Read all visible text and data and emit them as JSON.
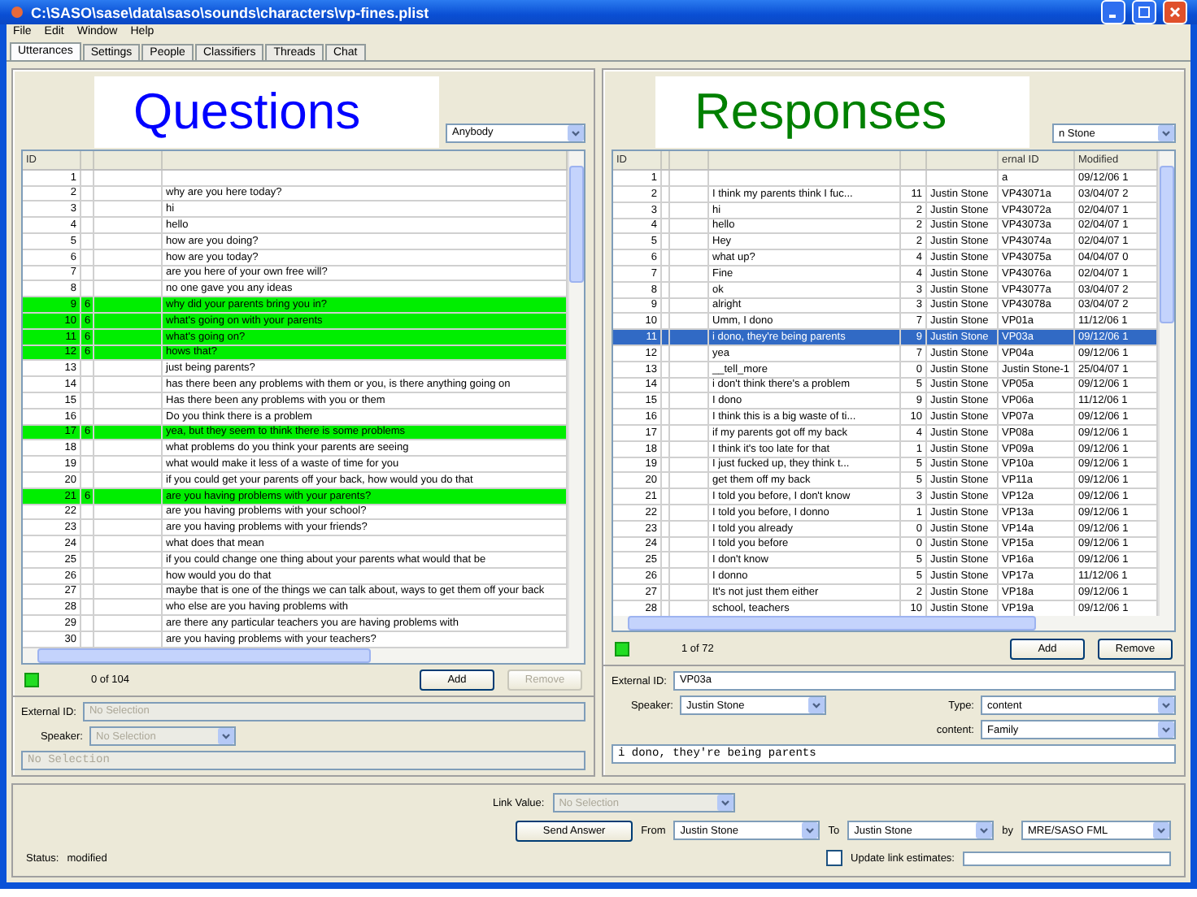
{
  "window": {
    "title": "C:\\SASO\\sase\\data\\saso\\sounds\\characters\\vp-fines.plist"
  },
  "menu": [
    "File",
    "Edit",
    "Window",
    "Help"
  ],
  "tabs": [
    {
      "label": "Utterances",
      "selected": true
    },
    {
      "label": "Settings",
      "selected": false
    },
    {
      "label": "People",
      "selected": false
    },
    {
      "label": "Classifiers",
      "selected": false
    },
    {
      "label": "Threads",
      "selected": false
    },
    {
      "label": "Chat",
      "selected": false
    }
  ],
  "questions": {
    "overlay": {
      "text": "Questions",
      "color": "#0000ff"
    },
    "filter": "Anybody",
    "header": {
      "number": "ID"
    },
    "rows": [
      {
        "number": "1",
        "highlighted": false
      },
      {
        "number": "2",
        "text": "why are you here today?",
        "highlighted": false
      },
      {
        "number": "3",
        "text": "hi",
        "highlighted": false
      },
      {
        "number": "4",
        "text": "hello",
        "highlighted": false
      },
      {
        "number": "5",
        "text": "how are you doing?",
        "highlighted": false
      },
      {
        "number": "6",
        "text": "how are you today?",
        "highlighted": false
      },
      {
        "number": "7",
        "text": "are you here of your own free will?",
        "highlighted": false
      },
      {
        "number": "8",
        "text": "no one gave you any ideas",
        "highlighted": false
      },
      {
        "number": "9",
        "mark": "6",
        "text": "why did your parents bring you in?",
        "highlighted": true
      },
      {
        "number": "10",
        "mark": "6",
        "text": "what's going on with your parents",
        "highlighted": true
      },
      {
        "number": "11",
        "mark": "6",
        "text": "what's going on?",
        "highlighted": true
      },
      {
        "number": "12",
        "mark": "6",
        "text": "hows that?",
        "highlighted": true
      },
      {
        "number": "13",
        "text": "just being parents?",
        "highlighted": false
      },
      {
        "number": "14",
        "text": "has there been any problems with them or you, is there anything going on",
        "highlighted": false
      },
      {
        "number": "15",
        "text": "Has there been any problems with you or them",
        "highlighted": false
      },
      {
        "number": "16",
        "text": "Do you think there is a problem",
        "highlighted": false
      },
      {
        "number": "17",
        "mark": "6",
        "text": "yea, but they seem to think there is some problems",
        "highlighted": true
      },
      {
        "number": "18",
        "text": "what problems do you think your parents are seeing",
        "highlighted": false
      },
      {
        "number": "19",
        "text": "what would make it less of a waste of time for you",
        "highlighted": false
      },
      {
        "number": "20",
        "text": "if you could get your parents off your back, how would you do that",
        "highlighted": false
      },
      {
        "number": "21",
        "mark": "6",
        "text": "are you having problems with your parents?",
        "highlighted": true
      },
      {
        "number": "22",
        "text": "are you having problems with your school?",
        "highlighted": false
      },
      {
        "number": "23",
        "text": "are you having problems with your friends?",
        "highlighted": false
      },
      {
        "number": "24",
        "text": "what does that mean",
        "highlighted": false
      },
      {
        "number": "25",
        "text": "if you could change one thing about your parents what would that be",
        "highlighted": false
      },
      {
        "number": "26",
        "text": "how would you do that",
        "highlighted": false
      },
      {
        "number": "27",
        "text": "maybe that is one of the things we can talk about, ways to get them off your back",
        "highlighted": false
      },
      {
        "number": "28",
        "text": "who else are you having problems with",
        "highlighted": false
      },
      {
        "number": "29",
        "text": "are there any particular teachers you are having problems with",
        "highlighted": false
      },
      {
        "number": "30",
        "text": "are you having problems with your teachers?",
        "highlighted": false
      }
    ],
    "count": "0 of 104",
    "buttons": [
      {
        "label": "Add",
        "disabled": false
      },
      {
        "label": "Remove",
        "disabled": true
      }
    ],
    "external_id": {
      "label": "External ID:",
      "value": "No Selection",
      "disabled": true
    },
    "speaker": {
      "label": "Speaker:",
      "value": "No Selection",
      "disabled": true
    },
    "text": {
      "value": "No Selection",
      "disabled": true
    }
  },
  "responses": {
    "overlay": {
      "text": "Responses",
      "color": "#008000"
    },
    "filter": "n Stone",
    "header": {
      "number": "ID",
      "external_id": "ernal ID",
      "modified": "Modified"
    },
    "rows": [
      {
        "number": "1",
        "external_id": "a",
        "modified": "09/12/06 1",
        "selected": false
      },
      {
        "number": "2",
        "text": "I think my parents think I fuc...",
        "count": "11",
        "speaker": "Justin Stone",
        "external_id": "VP43071a",
        "modified": "03/04/07 2",
        "selected": false
      },
      {
        "number": "3",
        "text": "hi",
        "count": "2",
        "speaker": "Justin Stone",
        "external_id": "VP43072a",
        "modified": "02/04/07 1",
        "selected": false
      },
      {
        "number": "4",
        "text": "hello",
        "count": "2",
        "speaker": "Justin Stone",
        "external_id": "VP43073a",
        "modified": "02/04/07 1",
        "selected": false
      },
      {
        "number": "5",
        "text": "Hey",
        "count": "2",
        "speaker": "Justin Stone",
        "external_id": "VP43074a",
        "modified": "02/04/07 1",
        "selected": false
      },
      {
        "number": "6",
        "text": "what up?",
        "count": "4",
        "speaker": "Justin Stone",
        "external_id": "VP43075a",
        "modified": "04/04/07 0",
        "selected": false
      },
      {
        "number": "7",
        "text": "Fine",
        "count": "4",
        "speaker": "Justin Stone",
        "external_id": "VP43076a",
        "modified": "02/04/07 1",
        "selected": false
      },
      {
        "number": "8",
        "text": "ok",
        "count": "3",
        "speaker": "Justin Stone",
        "external_id": "VP43077a",
        "modified": "03/04/07 2",
        "selected": false
      },
      {
        "number": "9",
        "text": "alright",
        "count": "3",
        "speaker": "Justin Stone",
        "external_id": "VP43078a",
        "modified": "03/04/07 2",
        "selected": false
      },
      {
        "number": "10",
        "text": "Umm, I dono",
        "count": "7",
        "speaker": "Justin Stone",
        "external_id": "VP01a",
        "modified": "11/12/06 1",
        "selected": false
      },
      {
        "number": "11",
        "text": "i dono, they're being parents",
        "count": "9",
        "speaker": "Justin Stone",
        "external_id": "VP03a",
        "modified": "09/12/06 1",
        "selected": true
      },
      {
        "number": "12",
        "text": "yea",
        "count": "7",
        "speaker": "Justin Stone",
        "external_id": "VP04a",
        "modified": "09/12/06 1",
        "selected": false
      },
      {
        "number": "13",
        "text": "__tell_more",
        "count": "0",
        "speaker": "Justin Stone",
        "external_id": "Justin Stone-1",
        "modified": "25/04/07 1",
        "selected": false
      },
      {
        "number": "14",
        "text": "i don't think there's a problem",
        "count": "5",
        "speaker": "Justin Stone",
        "external_id": "VP05a",
        "modified": "09/12/06 1",
        "selected": false
      },
      {
        "number": "15",
        "text": "I dono",
        "count": "9",
        "speaker": "Justin Stone",
        "external_id": "VP06a",
        "modified": "11/12/06 1",
        "selected": false
      },
      {
        "number": "16",
        "text": "I think this is a big waste of ti...",
        "count": "10",
        "speaker": "Justin Stone",
        "external_id": "VP07a",
        "modified": "09/12/06 1",
        "selected": false
      },
      {
        "number": "17",
        "text": "if my parents got off my back",
        "count": "4",
        "speaker": "Justin Stone",
        "external_id": "VP08a",
        "modified": "09/12/06 1",
        "selected": false
      },
      {
        "number": "18",
        "text": "I think it's too late for that",
        "count": "1",
        "speaker": "Justin Stone",
        "external_id": "VP09a",
        "modified": "09/12/06 1",
        "selected": false
      },
      {
        "number": "19",
        "text": "I just fucked up, they think t...",
        "count": "5",
        "speaker": "Justin Stone",
        "external_id": "VP10a",
        "modified": "09/12/06 1",
        "selected": false
      },
      {
        "number": "20",
        "text": "get them off my back",
        "count": "5",
        "speaker": "Justin Stone",
        "external_id": "VP11a",
        "modified": "09/12/06 1",
        "selected": false
      },
      {
        "number": "21",
        "text": "I told you before, I don't know",
        "count": "3",
        "speaker": "Justin Stone",
        "external_id": "VP12a",
        "modified": "09/12/06 1",
        "selected": false
      },
      {
        "number": "22",
        "text": "I told you before, I donno",
        "count": "1",
        "speaker": "Justin Stone",
        "external_id": "VP13a",
        "modified": "09/12/06 1",
        "selected": false
      },
      {
        "number": "23",
        "text": "I told you already",
        "count": "0",
        "speaker": "Justin Stone",
        "external_id": "VP14a",
        "modified": "09/12/06 1",
        "selected": false
      },
      {
        "number": "24",
        "text": "I told you before",
        "count": "0",
        "speaker": "Justin Stone",
        "external_id": "VP15a",
        "modified": "09/12/06 1",
        "selected": false
      },
      {
        "number": "25",
        "text": "I don't know",
        "count": "5",
        "speaker": "Justin Stone",
        "external_id": "VP16a",
        "modified": "09/12/06 1",
        "selected": false
      },
      {
        "number": "26",
        "text": "I donno",
        "count": "5",
        "speaker": "Justin Stone",
        "external_id": "VP17a",
        "modified": "11/12/06 1",
        "selected": false
      },
      {
        "number": "27",
        "text": "It's not just them either",
        "count": "2",
        "speaker": "Justin Stone",
        "external_id": "VP18a",
        "modified": "09/12/06 1",
        "selected": false
      },
      {
        "number": "28",
        "text": "school, teachers",
        "count": "10",
        "speaker": "Justin Stone",
        "external_id": "VP19a",
        "modified": "09/12/06 1",
        "selected": false
      }
    ],
    "count": "1 of 72",
    "buttons": [
      {
        "label": "Add",
        "disabled": false
      },
      {
        "label": "Remove",
        "disabled": false
      }
    ],
    "external_id": {
      "label": "External ID:",
      "value": "VP03a",
      "disabled": false
    },
    "speaker": {
      "label": "Speaker:",
      "value": "Justin Stone",
      "disabled": false
    },
    "type": {
      "label": "Type:",
      "value": "content"
    },
    "content": {
      "label": "content:",
      "value": "Family"
    },
    "text": {
      "value": "i dono, they're being parents",
      "disabled": false
    }
  },
  "link_value": {
    "label": "Link Value:",
    "value": "No Selection",
    "disabled": true
  },
  "send_button": "Send Answer",
  "from": {
    "label": "From",
    "value": "Justin Stone"
  },
  "to": {
    "label": "To",
    "value": "Justin Stone"
  },
  "by": {
    "label": "by",
    "value": "MRE/SASO FML"
  },
  "status": {
    "label": "Status:",
    "value": "modified"
  },
  "update_link_estimates": {
    "label": "Update link estimates:",
    "checked": false
  }
}
